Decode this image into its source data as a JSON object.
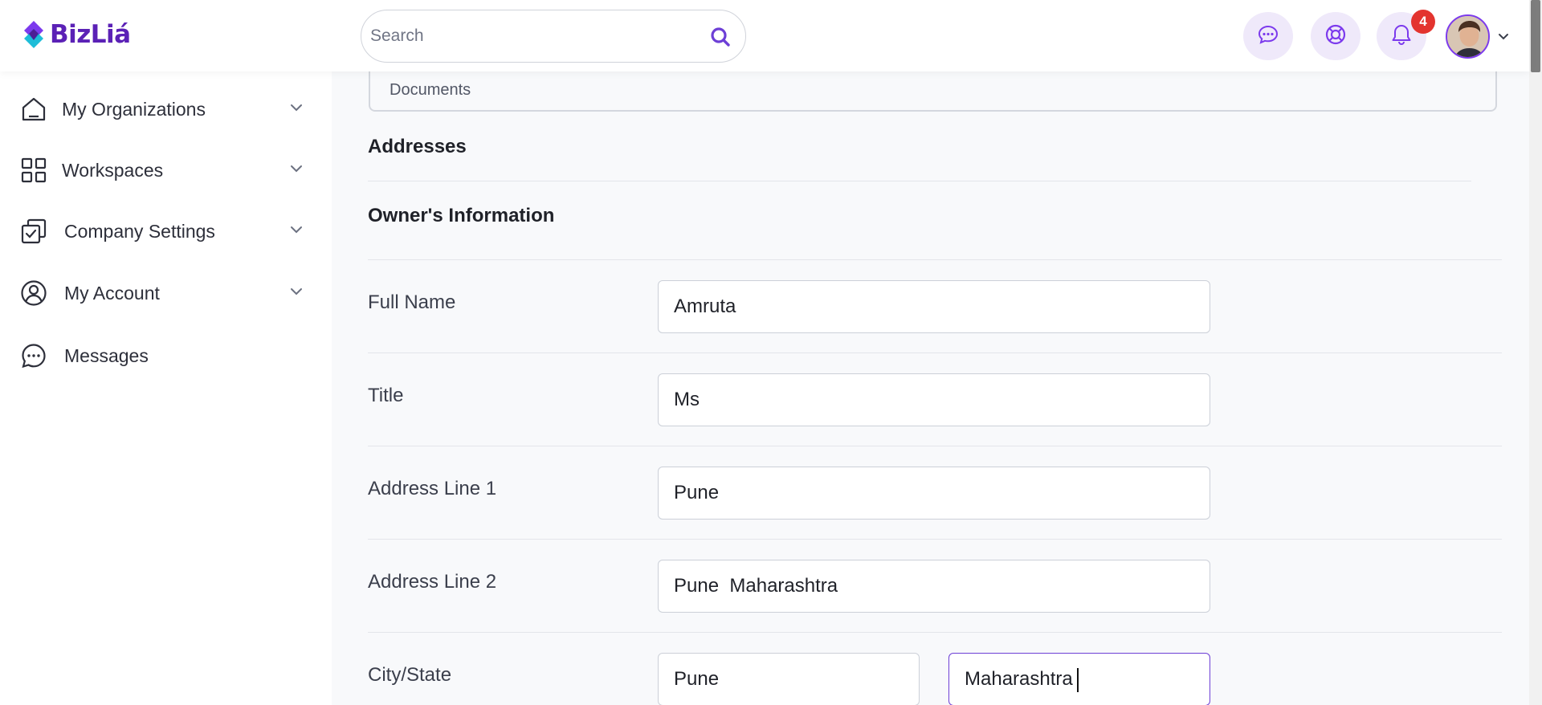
{
  "brand": {
    "name": "BizLiá"
  },
  "search": {
    "placeholder": "Search"
  },
  "header": {
    "notification_count": "4",
    "icons": [
      "chat-icon",
      "support-icon",
      "bell-icon"
    ]
  },
  "sidebar": {
    "items": [
      {
        "label": "My Organizations",
        "icon": "home-icon",
        "has_children": true
      },
      {
        "label": "Workspaces",
        "icon": "grid-icon",
        "has_children": true
      },
      {
        "label": "Company Settings",
        "icon": "settings-check-icon",
        "has_children": true
      },
      {
        "label": "My Account",
        "icon": "user-circle-icon",
        "has_children": true
      },
      {
        "label": "Messages",
        "icon": "message-icon",
        "has_children": false
      }
    ]
  },
  "main": {
    "documents_label": "Documents",
    "addresses_title": "Addresses",
    "owner_title": "Owner's Information",
    "fields": {
      "full_name": {
        "label": "Full Name",
        "value": "Amruta"
      },
      "title": {
        "label": "Title",
        "value": "Ms"
      },
      "address1": {
        "label": "Address Line 1",
        "value": "Pune"
      },
      "address2": {
        "label": "Address Line 2",
        "value": "Pune  Maharashtra"
      },
      "city_state": {
        "label": "City/State",
        "city": "Pune",
        "state": "Maharashtra"
      }
    }
  },
  "colors": {
    "brand": "#5b21b6",
    "accent": "#7c3aed",
    "badge": "#e3342f",
    "icon_bg": "#efe9fa"
  }
}
